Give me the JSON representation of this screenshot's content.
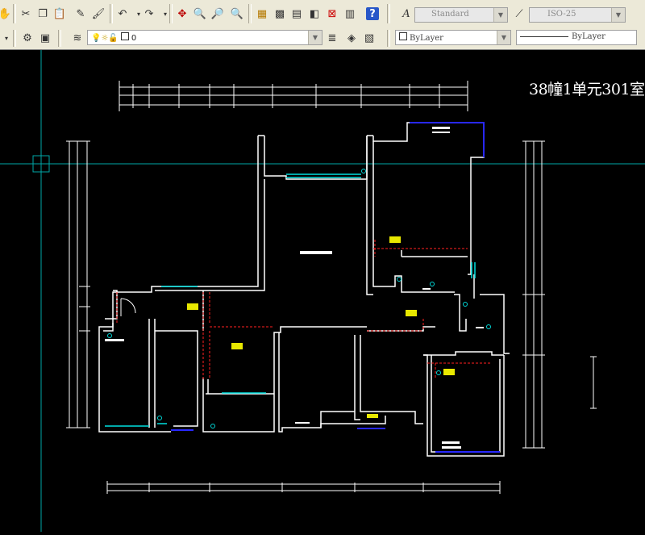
{
  "toolbar1": {
    "text_style": "Standard",
    "dim_style": "ISO-25",
    "icons": [
      "pan-icon",
      "cut-icon",
      "copy-icon",
      "paste-icon",
      "match-properties-icon",
      "brush-icon",
      "undo-icon",
      "redo-icon",
      "pan-realtime-icon",
      "zoom-realtime-icon",
      "zoom-window-icon",
      "zoom-previous-icon",
      "properties-icon",
      "design-center-icon",
      "tool-palettes-icon",
      "markup-icon",
      "calculator-icon",
      "help-icon",
      "text-style-icon",
      "dim-style-icon"
    ]
  },
  "toolbar2": {
    "layer_name": "0",
    "color": "ByLayer",
    "linetype": "ByLayer",
    "icons": [
      "layer-properties-icon",
      "layer-state-icon",
      "layer-visible-icon",
      "layer-freeze-icon",
      "layer-lock-icon",
      "layer-color-icon",
      "make-current-icon",
      "layer-previous-icon",
      "layer-tools-icon"
    ]
  },
  "drawing": {
    "title": "38幢1单元301室",
    "colors": {
      "wall": "#ffffff",
      "window": "#00ffff",
      "door_dashed": "#ff0000",
      "annotation": "#ffff00",
      "crosshair": "#00c0c0",
      "highlight": "#2020ff"
    }
  }
}
